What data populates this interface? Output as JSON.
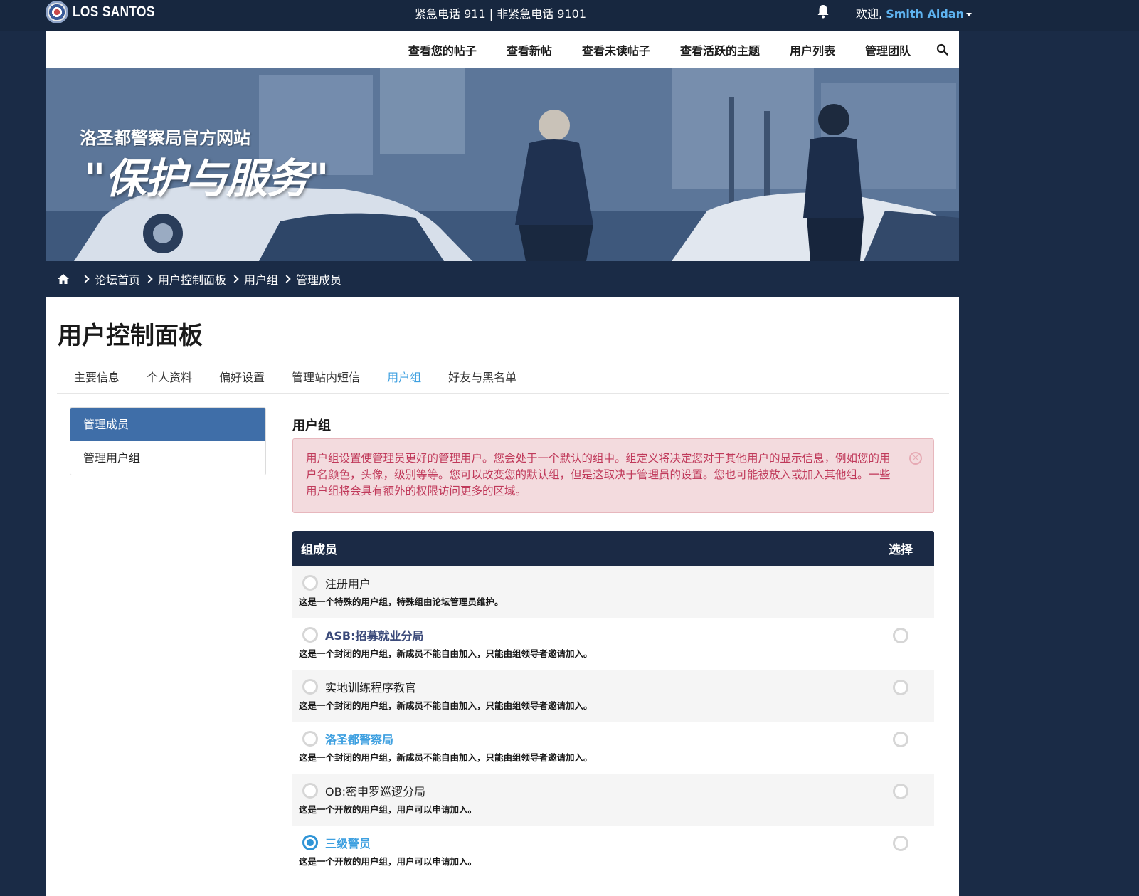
{
  "topbar": {
    "logo_text": "LOS SANTOS",
    "emergency": "紧急电话  911 | 非紧急电话  9101",
    "welcome_prefix": "欢迎, ",
    "username": "Smith Aidan"
  },
  "nav": {
    "links": [
      "查看您的帖子",
      "查看新帖",
      "查看未读帖子",
      "查看活跃的主题",
      "用户列表",
      "管理团队"
    ]
  },
  "banner": {
    "title": "洛圣都警察局官方网站",
    "slogan": "\"保护与服务\""
  },
  "breadcrumb": [
    "论坛首页",
    "用户控制面板",
    "用户组",
    "管理成员"
  ],
  "page_title": "用户控制面板",
  "tabs": [
    "主要信息",
    "个人资料",
    "偏好设置",
    "管理站内短信",
    "用户组",
    "好友与黑名单"
  ],
  "active_tab": "用户组",
  "sidemenu": [
    "管理成员",
    "管理用户组"
  ],
  "section_title": "用户组",
  "alert": "用户组设置使管理员更好的管理用户。您会处于一个默认的组中。组定义将决定您对于其他用户的显示信息，例如您的用户名颜色，头像，级别等等。您可以改变您的默认组，但是这取决于管理员的设置。您也可能被放入或加入其他组。一些用户组将会具有额外的权限访问更多的区域。",
  "table": {
    "col_members": "组成员",
    "col_select": "选择",
    "rows": [
      {
        "name": "注册用户",
        "desc": "这是一个特殊的用户组，特殊组由论坛管理员维护。"
      },
      {
        "name": "ASB:招募就业分局",
        "desc": "这是一个封闭的用户组，新成员不能自由加入，只能由组领导者邀请加入。"
      },
      {
        "name": "实地训练程序教官",
        "desc": "这是一个封闭的用户组，新成员不能自由加入，只能由组领导者邀请加入。"
      },
      {
        "name": "洛圣都警察局",
        "desc": "这是一个封闭的用户组，新成员不能自由加入，只能由组领导者邀请加入。"
      },
      {
        "name": "OB:密申罗巡逻分局",
        "desc": "这是一个开放的用户组，用户可以申请加入。"
      },
      {
        "name": "三级警员",
        "desc": "这是一个开放的用户组，用户可以申请加入。"
      }
    ]
  },
  "colors": {
    "page_bg": "#1a2b46",
    "accent_blue": "#3ea0e0",
    "menu_active": "#3f6ea8",
    "alert_text": "#c0395a"
  }
}
